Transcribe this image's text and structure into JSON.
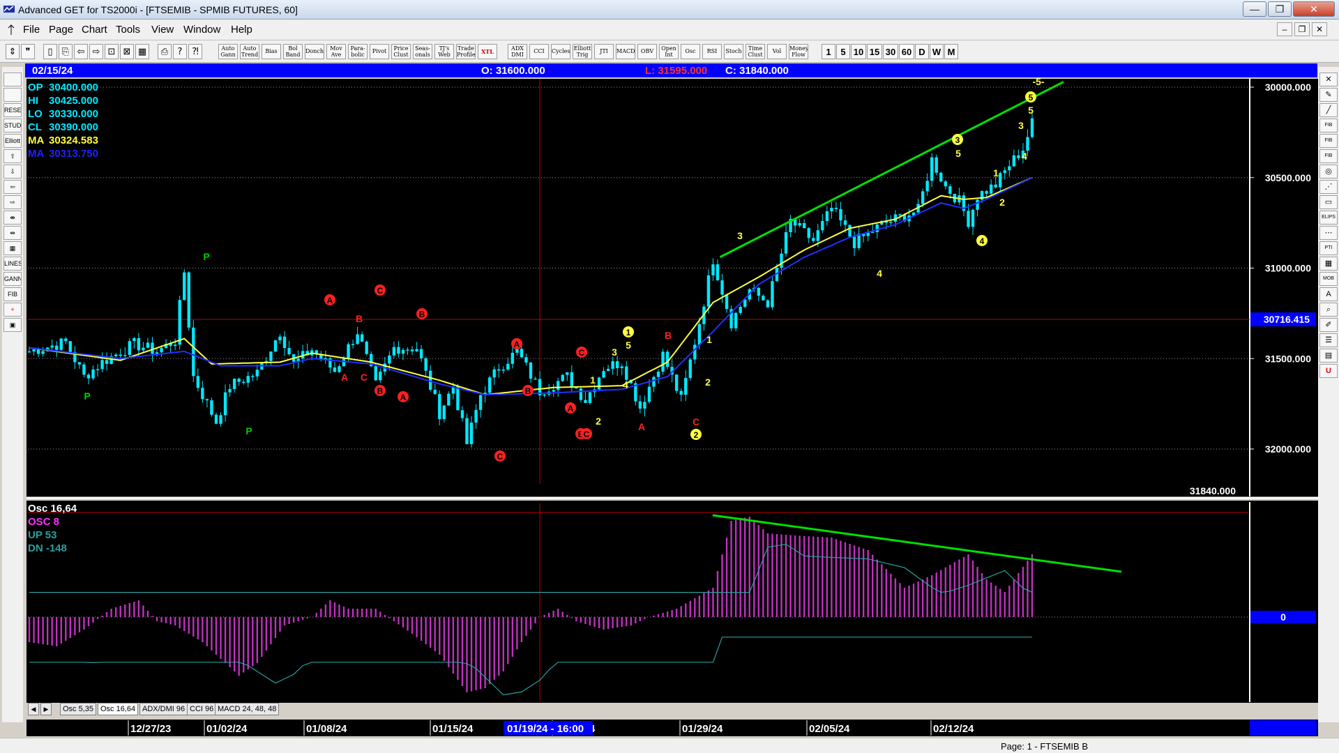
{
  "window": {
    "title": "Advanced GET for TS2000i - [FTSEMIB - SPMIB FUTURES, 60]",
    "controls": {
      "minimize": "—",
      "maximize": "❐",
      "close": "✕"
    }
  },
  "menu": [
    "File",
    "Page",
    "Chart",
    "Tools",
    "View",
    "Window",
    "Help"
  ],
  "mdi_controls": [
    "‒",
    "❐",
    "✕"
  ],
  "toolbar": {
    "icons": [
      "dock-icon",
      "open-icon",
      "new-page-icon",
      "copy-icon",
      "prev-icon",
      "next-icon",
      "fit-icon",
      "cross-icon",
      "grid-icon",
      "print-icon",
      "help-icon",
      "whats-this-icon"
    ],
    "studies": [
      [
        "Auto",
        "Gann"
      ],
      [
        "Auto",
        "Trend"
      ],
      [
        "Bias",
        ""
      ],
      [
        "Bol",
        "Band"
      ],
      [
        "Donch",
        ""
      ],
      [
        "Mov",
        "Ave"
      ],
      [
        "Para-",
        "bolic"
      ],
      [
        "Pivot",
        ""
      ],
      [
        "Price",
        "Clust"
      ],
      [
        "Seas-",
        "onals"
      ],
      [
        "TJ's",
        "Web"
      ],
      [
        "Trade",
        "Profile"
      ],
      [
        "XTL",
        ""
      ],
      [
        "ADX",
        "DMI"
      ],
      [
        "CCI",
        ""
      ],
      [
        "Cycles",
        ""
      ],
      [
        "Elliott",
        "Trig"
      ],
      [
        "JTI",
        ""
      ],
      [
        "MACD",
        ""
      ],
      [
        "OBV",
        ""
      ],
      [
        "Open",
        "Int"
      ],
      [
        "Osc",
        ""
      ],
      [
        "RSI",
        ""
      ],
      [
        "Stoch",
        ""
      ],
      [
        "Time",
        "Clust"
      ],
      [
        "Vol",
        ""
      ],
      [
        "Money",
        "Flow"
      ]
    ],
    "periods": [
      "1",
      "5",
      "10",
      "15",
      "30",
      "60",
      "D",
      "W",
      "M"
    ]
  },
  "left_tools": [
    "zoom-icon",
    "cycles-icon",
    "reset-icon",
    "study-icon",
    "elliott-icon",
    "up-icon",
    "down-icon",
    "left-icon",
    "right-icon",
    "expand-icon",
    "compress-icon",
    "grid-icon",
    "lines-icon",
    "gann-icon",
    "fib-icon",
    "cross-icon",
    "page-icon"
  ],
  "left_tool_labels": [
    "",
    "",
    "RESET",
    "STUDY",
    "Elliott",
    "⇧",
    "⇩",
    "⇦",
    "⇨",
    "⇼",
    "⇹",
    "▦",
    "LINES",
    "GANN",
    "FIB",
    "+",
    "▣"
  ],
  "right_tools": [
    "close-icon",
    "pencil-icon",
    "ruler-icon",
    "fib-ret-icon",
    "fib-ext-icon",
    "fib-time-icon",
    "circle-icon",
    "fan-icon",
    "box-icon",
    "ellipse-icon",
    "channel-icon",
    "pti-icon",
    "grid-icon",
    "mob-icon",
    "text-icon",
    "zoom-icon",
    "paint-icon",
    "list-icon",
    "table-icon",
    "u-icon"
  ],
  "right_tool_labels": [
    "✕",
    "✎",
    "╱",
    "FIB RET",
    "FIB EXT",
    "FIB TIME",
    "◎",
    "⋰",
    "▭",
    "ELIPS",
    "⋯",
    "PTI",
    "▦",
    "MOB",
    "A",
    "⌕",
    "✐",
    "☰",
    "▤",
    "U"
  ],
  "info_bar": {
    "date": "02/15/24",
    "open": "O: 31600.000",
    "low": "L:  31595.000",
    "close": "C:  31840.000"
  },
  "price_panel": {
    "readouts": [
      {
        "label": "OP",
        "value": "30400.000",
        "color": "#00e8ff"
      },
      {
        "label": "HI",
        "value": "30425.000",
        "color": "#00e8ff"
      },
      {
        "label": "LO",
        "value": "30330.000",
        "color": "#00e8ff"
      },
      {
        "label": "CL",
        "value": "30390.000",
        "color": "#00e8ff"
      },
      {
        "label": "MA",
        "value": "30324.583",
        "color": "#ffff40"
      },
      {
        "label": "MA",
        "value": "30313.750",
        "color": "#2020ff"
      }
    ],
    "y_ticks": [
      "32000.000",
      "31500.000",
      "31000.000",
      "30500.000",
      "30000.000"
    ],
    "cursor_price": "30716.415",
    "last_price": "31840.000"
  },
  "osc_panel": {
    "readouts": [
      {
        "text": "Osc 16,64",
        "color": "#ffffff"
      },
      {
        "text": "OSC 8",
        "color": "#ff30ff"
      },
      {
        "text": "UP   53",
        "color": "#2aa0a0"
      },
      {
        "text": "DN   -148",
        "color": "#2aa0a0"
      }
    ],
    "zero_label": "0"
  },
  "wave_labels": [
    {
      "t": "P",
      "c": "#00cc00",
      "cir": false
    },
    {
      "t": "P",
      "c": "#00cc00",
      "cir": false
    },
    {
      "t": "P",
      "c": "#00cc00",
      "cir": false
    },
    {
      "t": "A",
      "c": "#ff2020",
      "cir": true
    },
    {
      "t": "B",
      "c": "#ff2020",
      "cir": false
    },
    {
      "t": "A",
      "c": "#ff2020",
      "cir": false
    },
    {
      "t": "C",
      "c": "#ff2020",
      "cir": false
    },
    {
      "t": "B",
      "c": "#ff2020",
      "cir": true
    },
    {
      "t": "C",
      "c": "#ff2020",
      "cir": true
    },
    {
      "t": "B",
      "c": "#ff2020",
      "cir": true
    },
    {
      "t": "A",
      "c": "#ff2020",
      "cir": true
    },
    {
      "t": "C",
      "c": "#ff2020",
      "cir": true
    },
    {
      "t": "A",
      "c": "#ff2020",
      "cir": true
    },
    {
      "t": "B",
      "c": "#ff2020",
      "cir": true
    },
    {
      "t": "C",
      "c": "#ff2020",
      "cir": true
    },
    {
      "t": "B",
      "c": "#ff2020",
      "cir": true
    },
    {
      "t": "A",
      "c": "#ff2020",
      "cir": true
    },
    {
      "t": "C",
      "c": "#ff2020",
      "cir": true
    },
    {
      "t": "1",
      "c": "#ffff40",
      "cir": false
    },
    {
      "t": "2",
      "c": "#ffff40",
      "cir": false
    },
    {
      "t": "3",
      "c": "#ffff40",
      "cir": false
    },
    {
      "t": "4",
      "c": "#ffff40",
      "cir": false
    },
    {
      "t": "5",
      "c": "#ffff40",
      "cir": false
    },
    {
      "t": "1",
      "c": "#ffff40",
      "cir": true
    },
    {
      "t": "A",
      "c": "#ff2020",
      "cir": false
    },
    {
      "t": "B",
      "c": "#ff2020",
      "cir": false
    },
    {
      "t": "C",
      "c": "#ff2020",
      "cir": false
    },
    {
      "t": "2",
      "c": "#ffff40",
      "cir": true
    },
    {
      "t": "1",
      "c": "#ffff40",
      "cir": false
    },
    {
      "t": "2",
      "c": "#ffff40",
      "cir": false
    },
    {
      "t": "3",
      "c": "#ffff40",
      "cir": false
    },
    {
      "t": "4",
      "c": "#ffff40",
      "cir": false
    },
    {
      "t": "3",
      "c": "#ffff40",
      "cir": true
    },
    {
      "t": "5",
      "c": "#ffff40",
      "cir": false
    },
    {
      "t": "1",
      "c": "#ffff40",
      "cir": false
    },
    {
      "t": "2",
      "c": "#ffff40",
      "cir": false
    },
    {
      "t": "4",
      "c": "#ffff40",
      "cir": true
    },
    {
      "t": "3",
      "c": "#ffff40",
      "cir": false
    },
    {
      "t": "4",
      "c": "#ffff40",
      "cir": false
    },
    {
      "t": "5",
      "c": "#ffff40",
      "cir": false
    },
    {
      "t": "5",
      "c": "#ffff40",
      "cir": true
    },
    {
      "t": "-5-",
      "c": "#ffff40",
      "cir": false
    }
  ],
  "x_axis": [
    "12/27/23",
    "01/02/24",
    "01/08/24",
    "01/15/24",
    "01/22/24",
    "01/29/24",
    "02/05/24",
    "02/12/24"
  ],
  "cursor_date": "01/19/24 - 16:00",
  "subtabs": [
    "Osc 5,35",
    "Osc 16,64",
    "ADX/DMI 96",
    "CCI 96",
    "MACD 24, 48, 48"
  ],
  "status": "Page: 1 - FTSEMIB B",
  "chart_data": {
    "type": "candlestick",
    "symbol": "FTSEMIB - SPMIB FUTURES",
    "interval": "60",
    "ylim": [
      29700,
      32100
    ],
    "y_ticks": [
      30000,
      30500,
      31000,
      31500,
      32000
    ],
    "moving_averages": [
      {
        "name": "MA",
        "color": "#ffff40",
        "last": 30324.583
      },
      {
        "name": "MA",
        "color": "#2020ff",
        "last": 30313.75
      }
    ],
    "price_path": [
      [
        0,
        30540
      ],
      [
        8,
        30590
      ],
      [
        12,
        30400
      ],
      [
        16,
        30480
      ],
      [
        23,
        30580
      ],
      [
        28,
        30540
      ],
      [
        32,
        30600
      ],
      [
        34,
        30980
      ],
      [
        36,
        30400
      ],
      [
        41,
        30150
      ],
      [
        44,
        30350
      ],
      [
        50,
        30420
      ],
      [
        55,
        30650
      ],
      [
        58,
        30470
      ],
      [
        62,
        30550
      ],
      [
        67,
        30430
      ],
      [
        72,
        30650
      ],
      [
        76,
        30350
      ],
      [
        80,
        30560
      ],
      [
        85,
        30560
      ],
      [
        90,
        30200
      ],
      [
        93,
        30350
      ],
      [
        96,
        30030
      ],
      [
        99,
        30300
      ],
      [
        103,
        30450
      ],
      [
        107,
        30540
      ],
      [
        112,
        30320
      ],
      [
        118,
        30400
      ],
      [
        122,
        30270
      ],
      [
        126,
        30450
      ],
      [
        130,
        30480
      ],
      [
        134,
        30230
      ],
      [
        139,
        30520
      ],
      [
        143,
        30270
      ],
      [
        147,
        30700
      ],
      [
        150,
        31050
      ],
      [
        154,
        30700
      ],
      [
        158,
        30880
      ],
      [
        162,
        30810
      ],
      [
        167,
        31260
      ],
      [
        172,
        31150
      ],
      [
        176,
        31330
      ],
      [
        181,
        31140
      ],
      [
        187,
        31240
      ],
      [
        195,
        31320
      ],
      [
        198,
        31600
      ],
      [
        201,
        31450
      ],
      [
        204,
        31370
      ],
      [
        206,
        31260
      ],
      [
        208,
        31400
      ],
      [
        212,
        31460
      ],
      [
        215,
        31570
      ],
      [
        218,
        31660
      ],
      [
        220,
        31800
      ]
    ],
    "ma_fast_path": [
      [
        0,
        30560
      ],
      [
        20,
        30490
      ],
      [
        34,
        30610
      ],
      [
        40,
        30470
      ],
      [
        55,
        30480
      ],
      [
        62,
        30530
      ],
      [
        75,
        30480
      ],
      [
        90,
        30380
      ],
      [
        100,
        30300
      ],
      [
        115,
        30340
      ],
      [
        130,
        30350
      ],
      [
        140,
        30480
      ],
      [
        150,
        30810
      ],
      [
        160,
        30950
      ],
      [
        170,
        31100
      ],
      [
        180,
        31220
      ],
      [
        190,
        31270
      ],
      [
        200,
        31400
      ],
      [
        205,
        31380
      ],
      [
        210,
        31390
      ],
      [
        220,
        31500
      ]
    ],
    "ma_slow_path": [
      [
        0,
        30560
      ],
      [
        20,
        30500
      ],
      [
        34,
        30540
      ],
      [
        42,
        30460
      ],
      [
        55,
        30460
      ],
      [
        62,
        30500
      ],
      [
        75,
        30470
      ],
      [
        90,
        30360
      ],
      [
        100,
        30300
      ],
      [
        115,
        30310
      ],
      [
        130,
        30330
      ],
      [
        140,
        30400
      ],
      [
        150,
        30650
      ],
      [
        160,
        30910
      ],
      [
        170,
        31060
      ],
      [
        180,
        31170
      ],
      [
        190,
        31240
      ],
      [
        200,
        31360
      ],
      [
        205,
        31330
      ],
      [
        210,
        31380
      ],
      [
        220,
        31500
      ]
    ],
    "oscillator_path": [
      [
        0,
        -60
      ],
      [
        6,
        -70
      ],
      [
        12,
        -30
      ],
      [
        18,
        20
      ],
      [
        24,
        40
      ],
      [
        28,
        -10
      ],
      [
        32,
        -20
      ],
      [
        38,
        -60
      ],
      [
        46,
        -140
      ],
      [
        50,
        -110
      ],
      [
        56,
        -20
      ],
      [
        62,
        0
      ],
      [
        66,
        40
      ],
      [
        70,
        20
      ],
      [
        76,
        20
      ],
      [
        84,
        -40
      ],
      [
        90,
        -90
      ],
      [
        96,
        -180
      ],
      [
        100,
        -170
      ],
      [
        104,
        -130
      ],
      [
        108,
        -60
      ],
      [
        112,
        0
      ],
      [
        116,
        20
      ],
      [
        120,
        -10
      ],
      [
        126,
        -30
      ],
      [
        132,
        -20
      ],
      [
        136,
        0
      ],
      [
        142,
        20
      ],
      [
        150,
        70
      ],
      [
        154,
        230
      ],
      [
        158,
        240
      ],
      [
        162,
        200
      ],
      [
        168,
        195
      ],
      [
        176,
        190
      ],
      [
        184,
        160
      ],
      [
        192,
        70
      ],
      [
        198,
        100
      ],
      [
        206,
        150
      ],
      [
        210,
        90
      ],
      [
        214,
        60
      ],
      [
        220,
        150
      ]
    ],
    "osc_up_level": 53,
    "osc_dn_level": -148,
    "annotations": {
      "upper_trendline": [
        [
          150,
          31080
        ],
        [
          220,
          32010
        ]
      ],
      "osc_trendline": [
        [
          160,
          245
        ],
        [
          234,
          130
        ]
      ],
      "cursor_bar": 112,
      "cursor_price": 30716.415
    }
  }
}
